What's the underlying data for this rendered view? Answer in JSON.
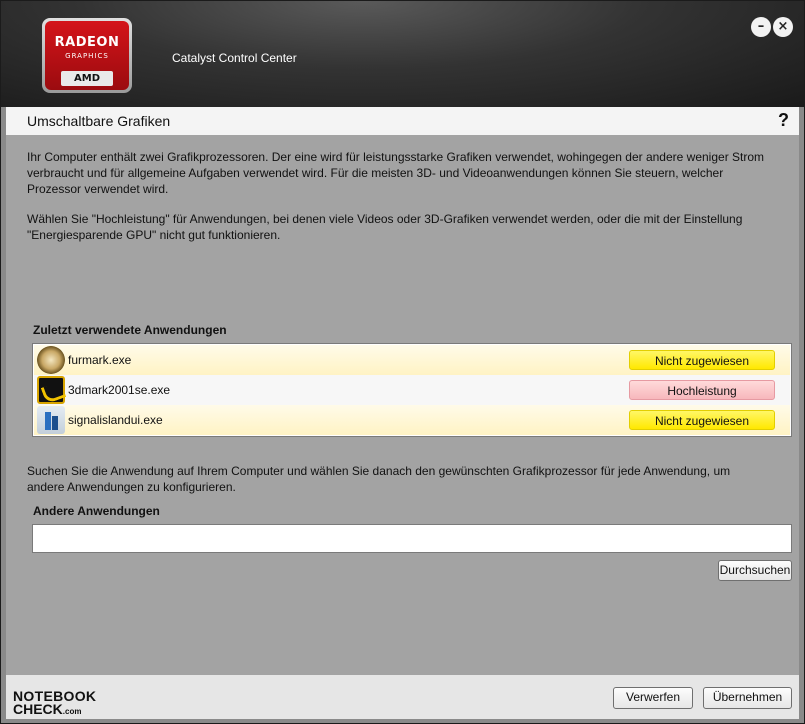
{
  "logo": {
    "brand": "RADEON",
    "sub": "GRAPHICS",
    "maker": "AMD"
  },
  "window": {
    "title": "Catalyst Control Center",
    "minimize": "–",
    "close": "×"
  },
  "page": {
    "title": "Umschaltbare Grafiken",
    "help": "?",
    "intro": "Ihr Computer enthält zwei Grafikprozessoren. Der eine wird für leistungsstarke Grafiken verwendet, wohingegen der andere weniger Strom verbraucht und für allgemeine Aufgaben verwendet wird. Für die meisten 3D- und Videoanwendungen können Sie steuern, welcher Prozessor verwendet wird.",
    "hint": "Wählen Sie \"Hochleistung\" für Anwendungen, bei denen viele Videos oder 3D-Grafiken verwendet werden, oder die mit der Einstellung \"Energiesparende GPU\" nicht gut funktionieren."
  },
  "recent": {
    "label": "Zuletzt verwendete Anwendungen",
    "apps": [
      {
        "name": "furmark.exe",
        "icon": "furmark-icon",
        "gpu": "Nicht zugewiesen",
        "gpu_color": "#ffee22"
      },
      {
        "name": "3dmark2001se.exe",
        "icon": "3dmark-icon",
        "gpu": "Hochleistung",
        "gpu_color": "#f7c2c6"
      },
      {
        "name": "signalislandui.exe",
        "icon": "signalisland-icon",
        "gpu": "Nicht zugewiesen",
        "gpu_color": "#ffee22"
      }
    ]
  },
  "other": {
    "instructions": "Suchen Sie die Anwendung auf Ihrem Computer und wählen Sie danach den gewünschten Grafikprozessor für jede Anwendung, um andere Anwendungen zu konfigurieren.",
    "label": "Andere Anwendungen",
    "input_value": "",
    "browse": "Durchsuchen"
  },
  "footer": {
    "discard": "Verwerfen",
    "apply": "Übernehmen",
    "watermark_line1": "NOTEBOOK",
    "watermark_line2": "CHECK",
    "watermark_suffix": ".com"
  }
}
